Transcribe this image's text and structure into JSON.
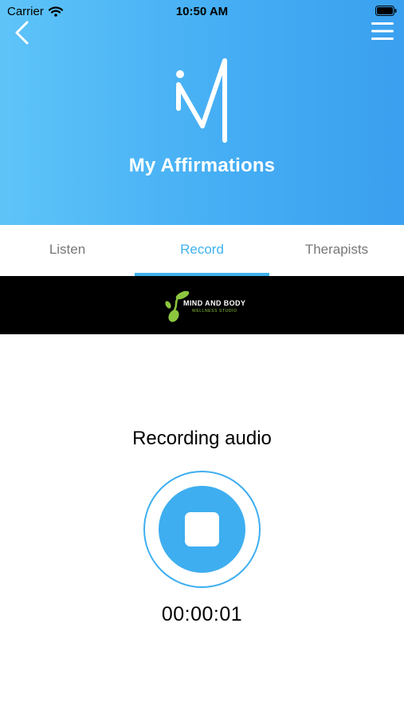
{
  "status_bar": {
    "carrier": "Carrier",
    "time": "10:50 AM",
    "icons": [
      "wifi-icon",
      "battery-icon"
    ]
  },
  "header": {
    "title": "My Affirmations",
    "logo_letter": "M",
    "back_icon": "chevron-left-icon",
    "menu_icon": "hamburger-menu-icon",
    "colors": {
      "gradient_start": "#5ec4f8",
      "gradient_end": "#3aa0ef",
      "accent": "#3eb2ee"
    }
  },
  "tabs": [
    {
      "label": "Listen",
      "active": false
    },
    {
      "label": "Record",
      "active": true
    },
    {
      "label": "Therapists",
      "active": false
    }
  ],
  "banner": {
    "brand_name": "MIND AND BODY",
    "brand_subtitle": "WELLNESS STUDIO"
  },
  "recorder": {
    "status": "Recording audio",
    "timer": "00:00:01",
    "control_icon": "stop-icon"
  }
}
